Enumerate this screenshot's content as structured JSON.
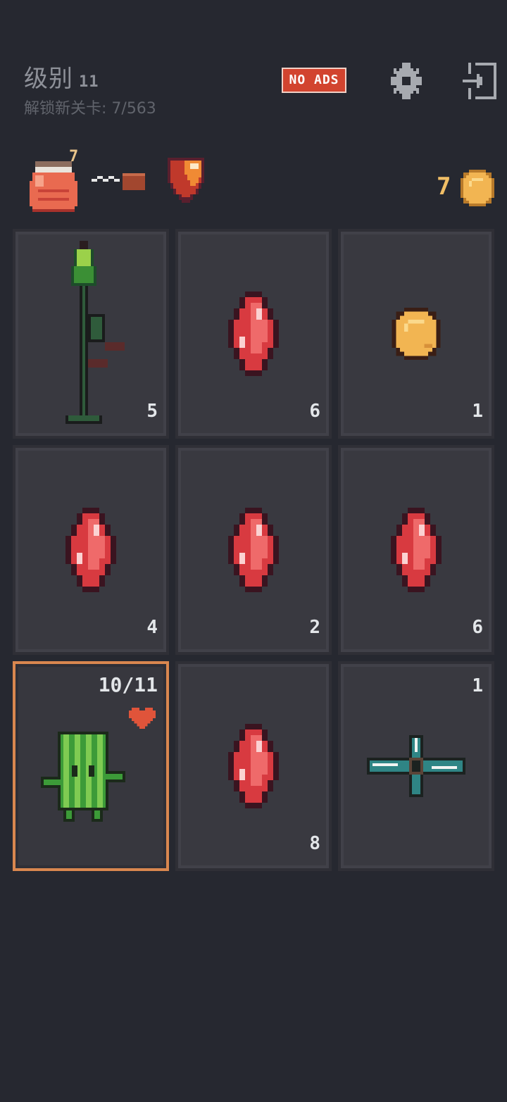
{
  "header": {
    "level_label": "级别",
    "level_value": "11",
    "unlock_text": "解锁新关卡: 7/563",
    "no_ads_label": "NO ADS"
  },
  "status": {
    "potion_count": "7",
    "coins": "7",
    "icons": [
      "potion-icon",
      "rope-icon",
      "shield-icon",
      "coin-icon"
    ]
  },
  "grid": {
    "cards": [
      {
        "item": "spear",
        "count": "5"
      },
      {
        "item": "red-gem",
        "count": "6"
      },
      {
        "item": "coin",
        "count": "1"
      },
      {
        "item": "red-gem",
        "count": "4"
      },
      {
        "item": "red-gem",
        "count": "2"
      },
      {
        "item": "red-gem",
        "count": "6"
      },
      {
        "item": "cactus-hero",
        "hp": "10/11",
        "selected": true
      },
      {
        "item": "red-gem",
        "count": "8"
      },
      {
        "item": "shuriken",
        "count": "1"
      }
    ]
  },
  "colors": {
    "background": "#262830",
    "card": "#393940",
    "selected_border": "#d9874f",
    "no_ads_bg": "#d2442f",
    "coin": "#f0be66"
  }
}
